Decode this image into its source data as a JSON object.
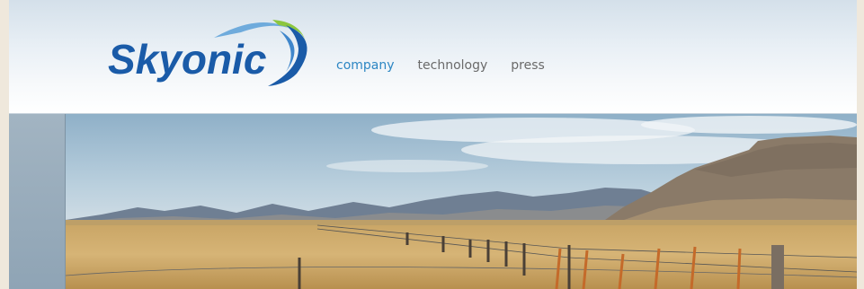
{
  "brand": {
    "name": "Skyonic"
  },
  "nav": {
    "items": [
      {
        "label": "company",
        "active": true
      },
      {
        "label": "technology",
        "active": false
      },
      {
        "label": "press",
        "active": false
      }
    ]
  },
  "colors": {
    "logo_blue": "#1a5ba8",
    "nav_active": "#2c86c3",
    "nav_inactive": "#6a6a6a",
    "logo_swoosh_green": "#8cc63f"
  }
}
